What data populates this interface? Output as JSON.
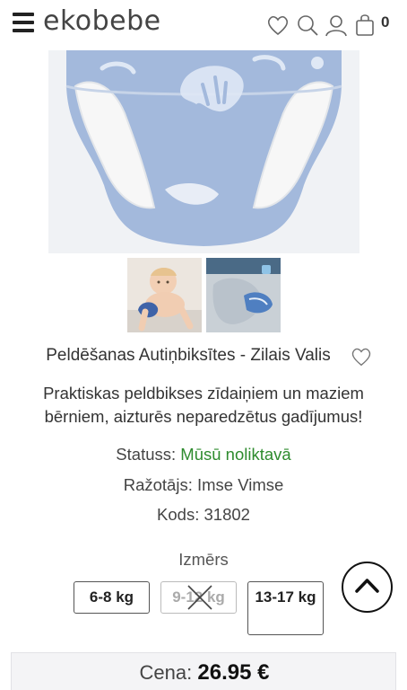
{
  "header": {
    "logo": "ekobebe",
    "cart_count": "0",
    "icons": [
      "menu-icon",
      "heart-icon",
      "search-icon",
      "user-icon",
      "bag-icon"
    ]
  },
  "gallery": {
    "main_image": "swim-diaper-blue-whale-pattern",
    "thumbnails": [
      "baby-wearing-swim-diaper",
      "swim-diaper-with-towel"
    ]
  },
  "product": {
    "title": "Peldēšanas Autiņbiksītes - Zilais Valis",
    "description": "Praktiskas peldbikses zīdaiņiem un maziem bērniem, aizturēs neparedzētus gadījumus!",
    "status_label": "Statuss:",
    "status_value": "Mūsū noliktavā",
    "manufacturer_label": "Ražotājs:",
    "manufacturer_value": "Imse Vimse",
    "code_label": "Kods:",
    "code_value": "31802"
  },
  "sizes": {
    "label": "Izmērs",
    "options": [
      {
        "label": "6-8 kg",
        "available": true
      },
      {
        "label": "9-12 kg",
        "available": false
      },
      {
        "label": "13-17 kg",
        "available": true
      }
    ]
  },
  "price": {
    "label": "Cena:",
    "value": "26.95 €"
  },
  "colors": {
    "status_green": "#2e8b2e",
    "diaper_blue": "#9fb7d9"
  }
}
